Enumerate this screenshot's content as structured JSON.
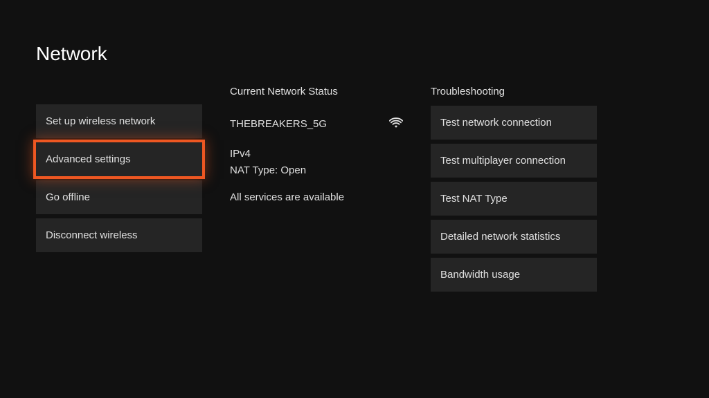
{
  "title": "Network",
  "left": {
    "items": [
      {
        "label": "Set up wireless network"
      },
      {
        "label": "Advanced settings"
      },
      {
        "label": "Go offline"
      },
      {
        "label": "Disconnect wireless"
      }
    ]
  },
  "status": {
    "heading": "Current Network Status",
    "ssid": "THEBREAKERS_5G",
    "ip_version": "IPv4",
    "nat": "NAT Type: Open",
    "services": "All services are available"
  },
  "troubleshoot": {
    "heading": "Troubleshooting",
    "items": [
      {
        "label": "Test network connection"
      },
      {
        "label": "Test multiplayer connection"
      },
      {
        "label": "Test NAT Type"
      },
      {
        "label": "Detailed network statistics"
      },
      {
        "label": "Bandwidth usage"
      }
    ]
  }
}
